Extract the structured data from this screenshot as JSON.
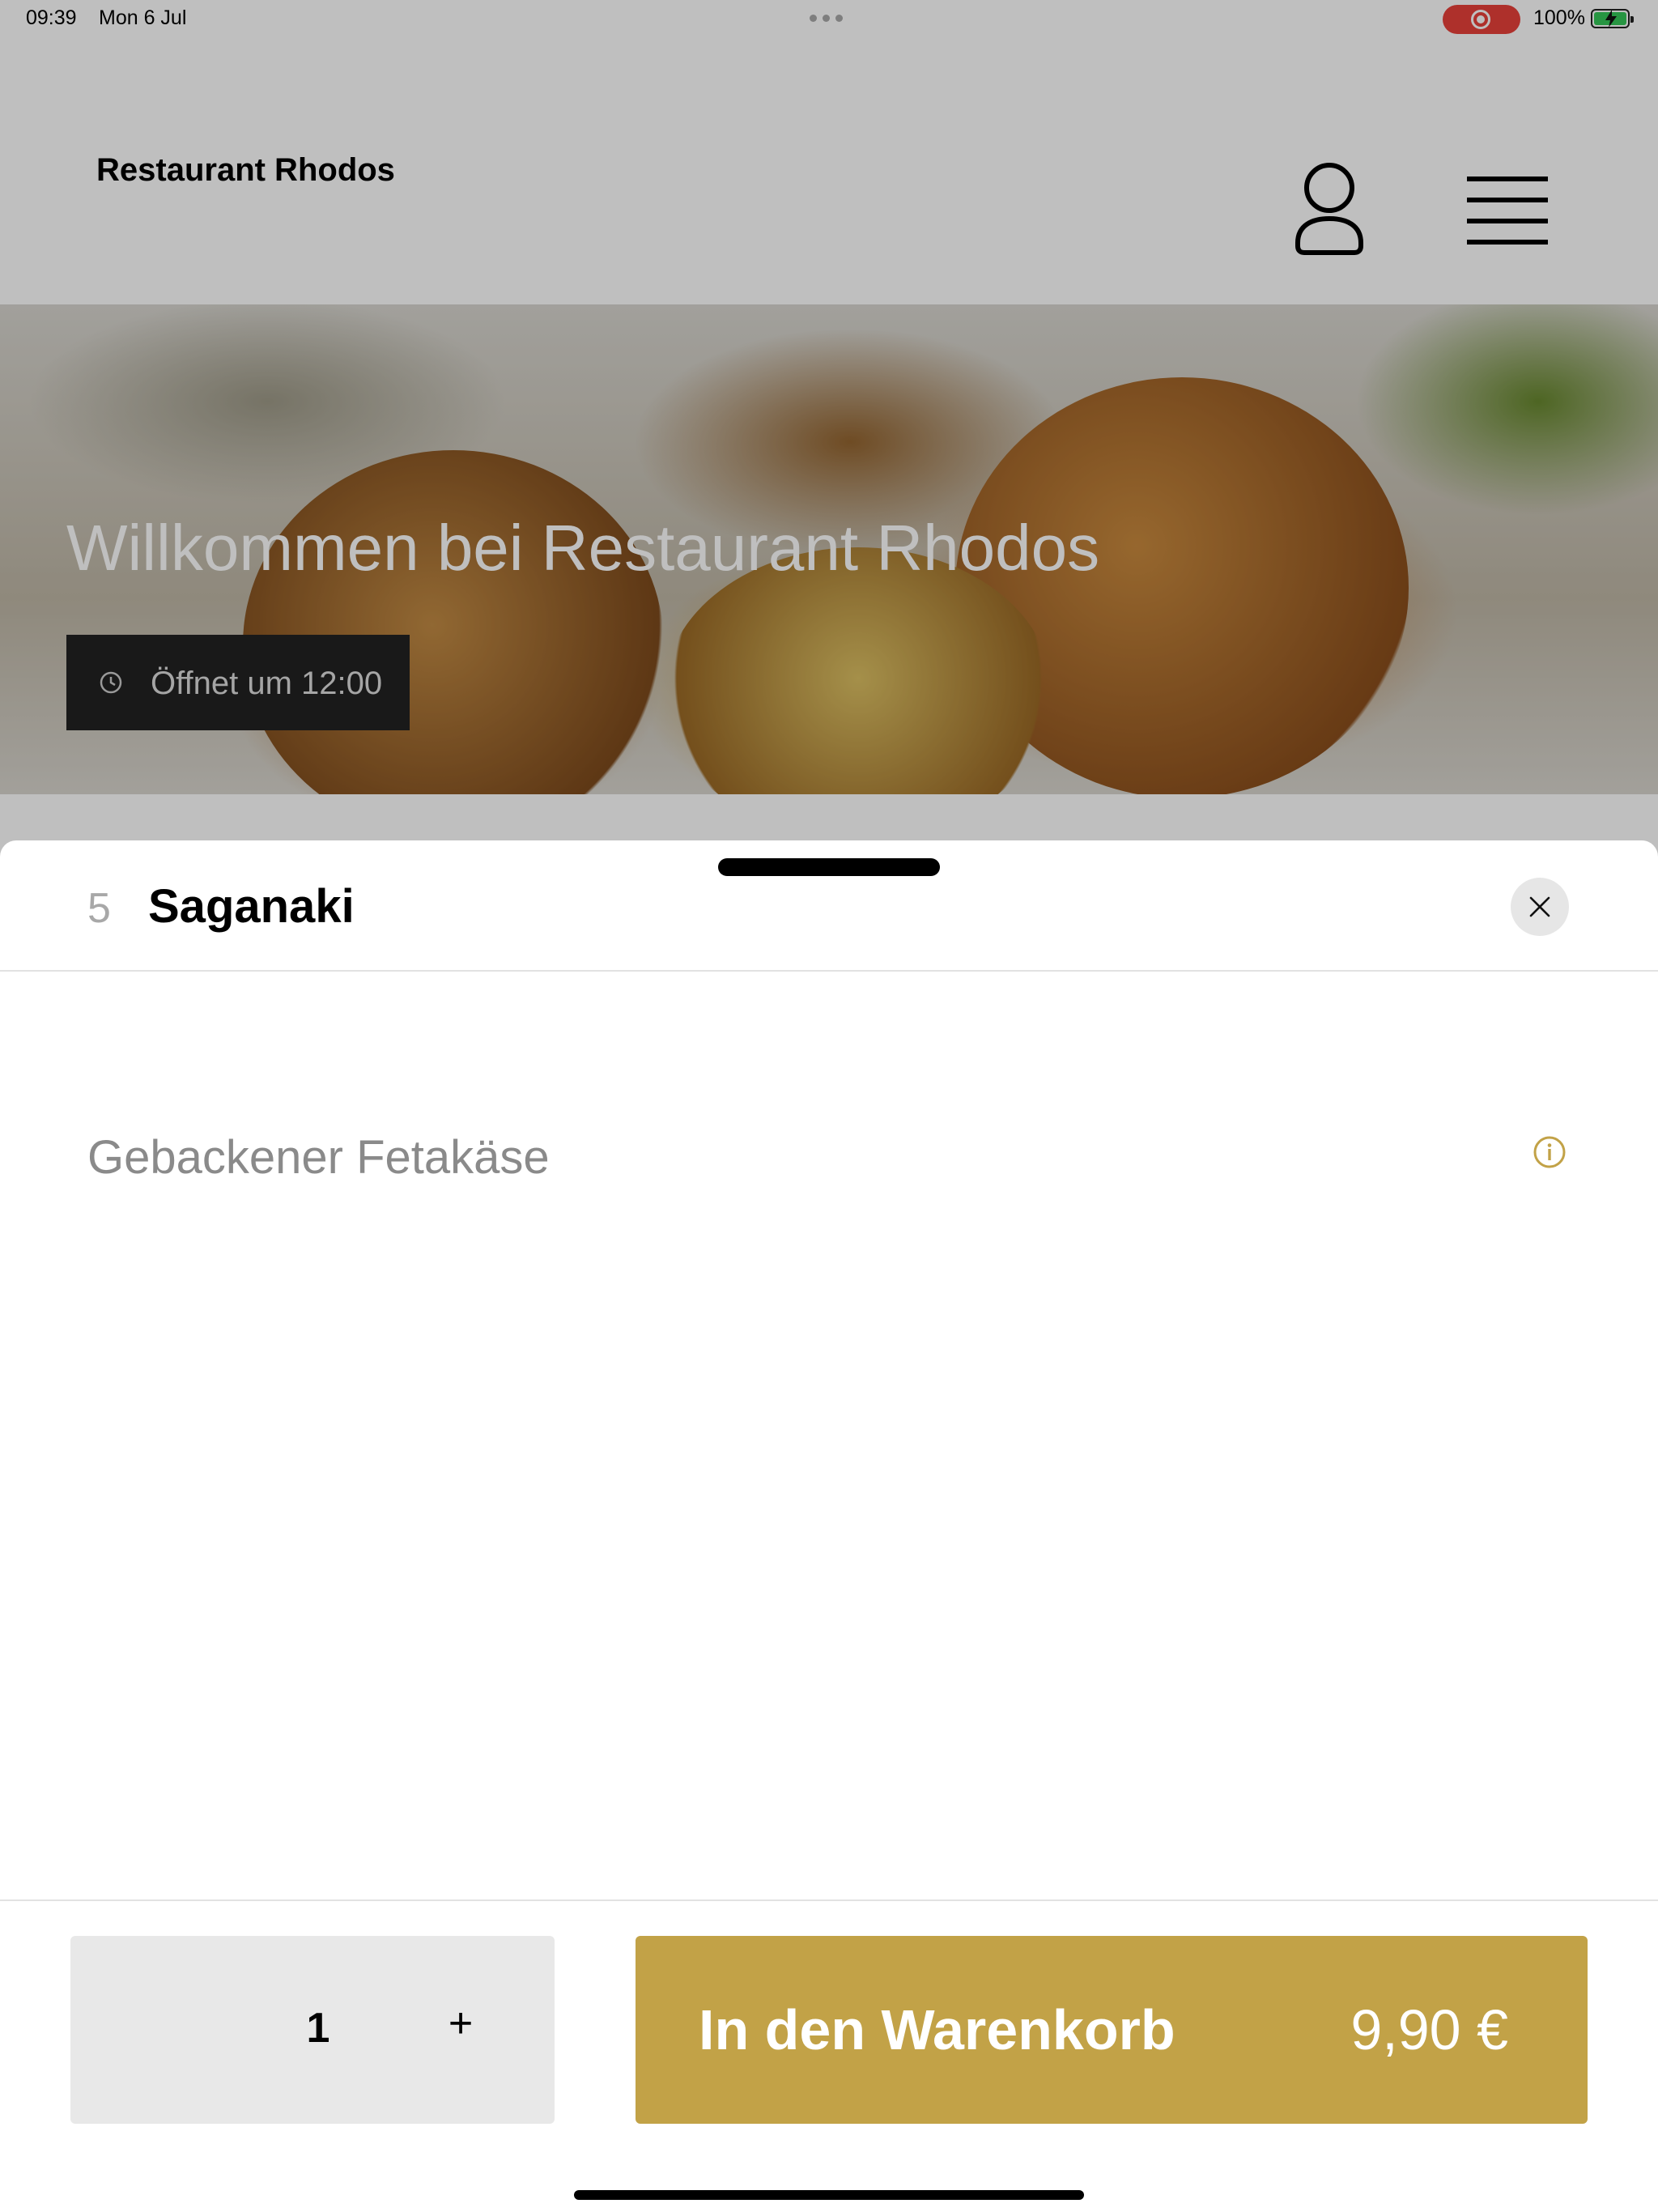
{
  "status_bar": {
    "time": "09:39",
    "date": "Mon 6 Jul",
    "battery": "100%"
  },
  "header": {
    "title": "Restaurant Rhodos",
    "icons": [
      "user-icon",
      "menu-icon"
    ]
  },
  "hero": {
    "title": "Willkommen bei Restaurant Rhodos",
    "badge": "Öffnet um 12:00",
    "badge_icon": "clock-icon"
  },
  "item_sheet": {
    "number": "5",
    "name": "Saganaki",
    "description": "Gebackener Fetakäse",
    "icons": [
      "close-icon",
      "info-icon"
    ]
  },
  "order": {
    "quantity": "1",
    "plus_label": "+",
    "add_to_cart_label": "In den Warenkorb",
    "price": "9,90 €"
  },
  "colors": {
    "accent": "#c2a247",
    "recording": "#e8403a",
    "battery": "#35c759"
  }
}
